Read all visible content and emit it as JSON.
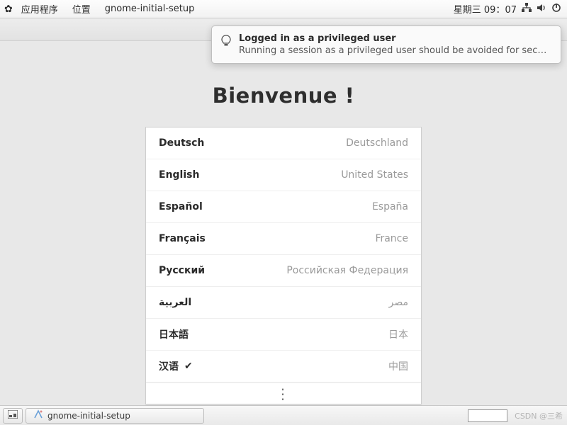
{
  "top_panel": {
    "apps_label": "应用程序",
    "places_label": "位置",
    "app_name": "gnome-initial-setup",
    "clock": "星期三 09：07"
  },
  "notification": {
    "title": "Logged in as a privileged user",
    "detail": "Running a session as a privileged user should be avoided for securit…"
  },
  "welcome_heading": "Bienvenue !",
  "languages": [
    {
      "name": "Deutsch",
      "region": "Deutschland",
      "selected": false
    },
    {
      "name": "English",
      "region": "United States",
      "selected": false
    },
    {
      "name": "Español",
      "region": "España",
      "selected": false
    },
    {
      "name": "Français",
      "region": "France",
      "selected": false
    },
    {
      "name": "Русский",
      "region": "Российская Федерация",
      "selected": false
    },
    {
      "name": "العربية",
      "region": "مصر",
      "selected": false
    },
    {
      "name": "日本語",
      "region": "日本",
      "selected": false
    },
    {
      "name": "汉语",
      "region": "中国",
      "selected": true
    }
  ],
  "more_indicator": "⋮",
  "bottom_panel": {
    "task_label": "gnome-initial-setup",
    "watermark": "CSDN @三希"
  }
}
